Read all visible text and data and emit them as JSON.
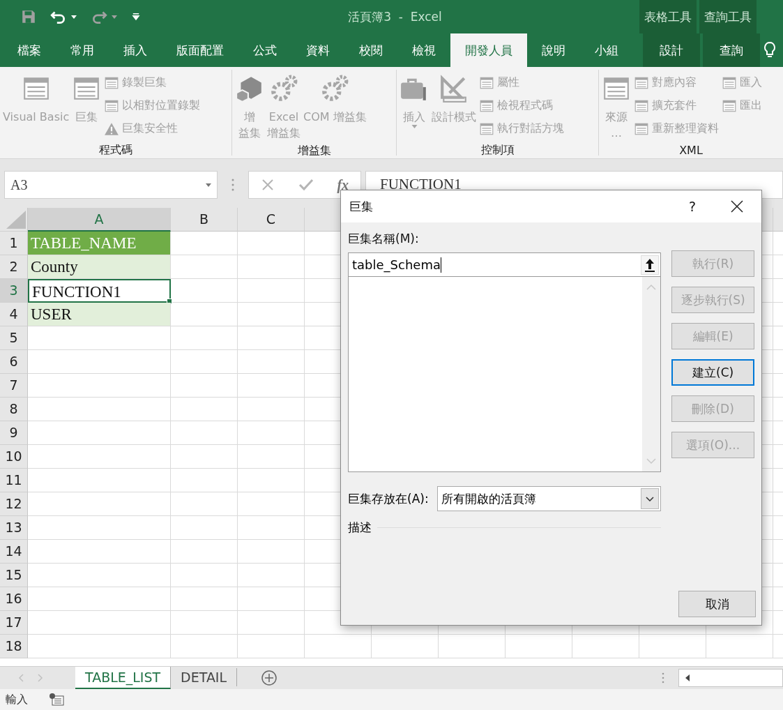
{
  "title_bar": {
    "title": "活頁簿3  -  Excel",
    "context_groups": [
      {
        "label": "表格工具"
      },
      {
        "label": "查詢工具"
      }
    ]
  },
  "quick_access": [
    {
      "kind": "save",
      "disabled": true,
      "dropdown": false
    },
    {
      "kind": "undo",
      "disabled": false,
      "dropdown": true
    },
    {
      "kind": "redo",
      "disabled": true,
      "dropdown": true
    },
    {
      "kind": "customize",
      "disabled": false,
      "dropdown": false
    }
  ],
  "ribbon_tabs": [
    {
      "label": "檔案",
      "selected": false,
      "contextual": false
    },
    {
      "label": "常用",
      "selected": false,
      "contextual": false
    },
    {
      "label": "插入",
      "selected": false,
      "contextual": false
    },
    {
      "label": "版面配置",
      "selected": false,
      "contextual": false
    },
    {
      "label": "公式",
      "selected": false,
      "contextual": false
    },
    {
      "label": "資料",
      "selected": false,
      "contextual": false
    },
    {
      "label": "校閱",
      "selected": false,
      "contextual": false
    },
    {
      "label": "檢視",
      "selected": false,
      "contextual": false
    },
    {
      "label": "開發人員",
      "selected": true,
      "contextual": false
    },
    {
      "label": "說明",
      "selected": false,
      "contextual": false
    },
    {
      "label": "小組",
      "selected": false,
      "contextual": false
    },
    {
      "label": "設計",
      "selected": false,
      "contextual": true
    },
    {
      "label": "查詢",
      "selected": false,
      "contextual": true
    }
  ],
  "ribbon_groups": [
    {
      "label": "程式碼",
      "columns": [
        {
          "kind": "large",
          "lines": [
            "Visual Basic"
          ],
          "disabled": true,
          "dropdown": false
        },
        {
          "kind": "large",
          "lines": [
            "巨集"
          ],
          "disabled": true,
          "dropdown": false
        },
        {
          "kind": "small",
          "items": [
            {
              "label": "錄製巨集",
              "disabled": true
            },
            {
              "label": "以相對位置錄製",
              "disabled": true
            },
            {
              "label": "巨集安全性",
              "disabled": true
            }
          ]
        }
      ]
    },
    {
      "label": "增益集",
      "columns": [
        {
          "kind": "large",
          "lines": [
            "增",
            "益集"
          ],
          "disabled": true,
          "dropdown": false
        },
        {
          "kind": "large",
          "lines": [
            "Excel",
            "增益集"
          ],
          "disabled": true,
          "dropdown": false
        },
        {
          "kind": "large",
          "lines": [
            "COM 增益集"
          ],
          "disabled": true,
          "dropdown": false
        }
      ]
    },
    {
      "label": "控制項",
      "columns": [
        {
          "kind": "large",
          "lines": [
            "插入"
          ],
          "disabled": true,
          "dropdown": true
        },
        {
          "kind": "large",
          "lines": [
            "設計模式"
          ],
          "disabled": true,
          "dropdown": false
        },
        {
          "kind": "small",
          "items": [
            {
              "label": "屬性",
              "disabled": true
            },
            {
              "label": "檢視程式碼",
              "disabled": true
            },
            {
              "label": "執行對話方塊",
              "disabled": true
            }
          ]
        }
      ]
    },
    {
      "label": "XML",
      "columns": [
        {
          "kind": "large",
          "lines": [
            "來源",
            "…"
          ],
          "disabled": true,
          "dropdown": false
        },
        {
          "kind": "small",
          "items": [
            {
              "label": "對應內容",
              "disabled": true
            },
            {
              "label": "擴充套件",
              "disabled": true
            },
            {
              "label": "重新整理資料",
              "disabled": true
            }
          ]
        },
        {
          "kind": "small",
          "items": [
            {
              "label": "匯入",
              "disabled": true
            },
            {
              "label": "匯出",
              "disabled": true
            }
          ]
        }
      ]
    }
  ],
  "formula_bar": {
    "name_box": "A3",
    "function_label": "fx",
    "formula": "FUNCTION1"
  },
  "grid": {
    "columns": [
      {
        "label": "A",
        "selected": true
      },
      {
        "label": "B",
        "selected": false
      },
      {
        "label": "C",
        "selected": false
      }
    ],
    "rows": [
      {
        "label": "1",
        "selected": false,
        "cell": {
          "text": "TABLE_NAME",
          "kind": "header",
          "active": false
        }
      },
      {
        "label": "2",
        "selected": false,
        "cell": {
          "text": "County",
          "kind": "band",
          "active": false
        }
      },
      {
        "label": "3",
        "selected": true,
        "cell": {
          "text": "FUNCTION1",
          "kind": "plain",
          "active": true
        }
      },
      {
        "label": "4",
        "selected": false,
        "cell": {
          "text": "USER",
          "kind": "band",
          "active": false
        }
      },
      {
        "label": "5",
        "selected": false
      },
      {
        "label": "6",
        "selected": false
      },
      {
        "label": "7",
        "selected": false
      },
      {
        "label": "8",
        "selected": false
      },
      {
        "label": "9",
        "selected": false
      },
      {
        "label": "10",
        "selected": false
      },
      {
        "label": "11",
        "selected": false
      },
      {
        "label": "12",
        "selected": false
      },
      {
        "label": "13",
        "selected": false
      },
      {
        "label": "14",
        "selected": false
      },
      {
        "label": "15",
        "selected": false
      },
      {
        "label": "16",
        "selected": false
      },
      {
        "label": "17",
        "selected": false
      },
      {
        "label": "18",
        "selected": false
      }
    ]
  },
  "sheet_tabs": [
    {
      "label": "TABLE_LIST",
      "selected": true
    },
    {
      "label": "DETAIL",
      "selected": false
    }
  ],
  "status_bar": {
    "mode": "輸入"
  },
  "dialog": {
    "title": "巨集",
    "help": "?",
    "name_label": "巨集名稱(M):",
    "name_value": "table_Schema",
    "buttons": [
      {
        "label": "執行(R)",
        "disabled": true,
        "default": false
      },
      {
        "label": "逐步執行(S)",
        "disabled": true,
        "default": false
      },
      {
        "label": "編輯(E)",
        "disabled": true,
        "default": false
      },
      {
        "label": "建立(C)",
        "disabled": false,
        "default": true
      },
      {
        "label": "刪除(D)",
        "disabled": true,
        "default": false
      },
      {
        "label": "選項(O)...",
        "disabled": true,
        "default": false
      }
    ],
    "store_label": "巨集存放在(A):",
    "store_value": "所有開啟的活頁簿",
    "description_label": "描述",
    "cancel": "取消"
  }
}
